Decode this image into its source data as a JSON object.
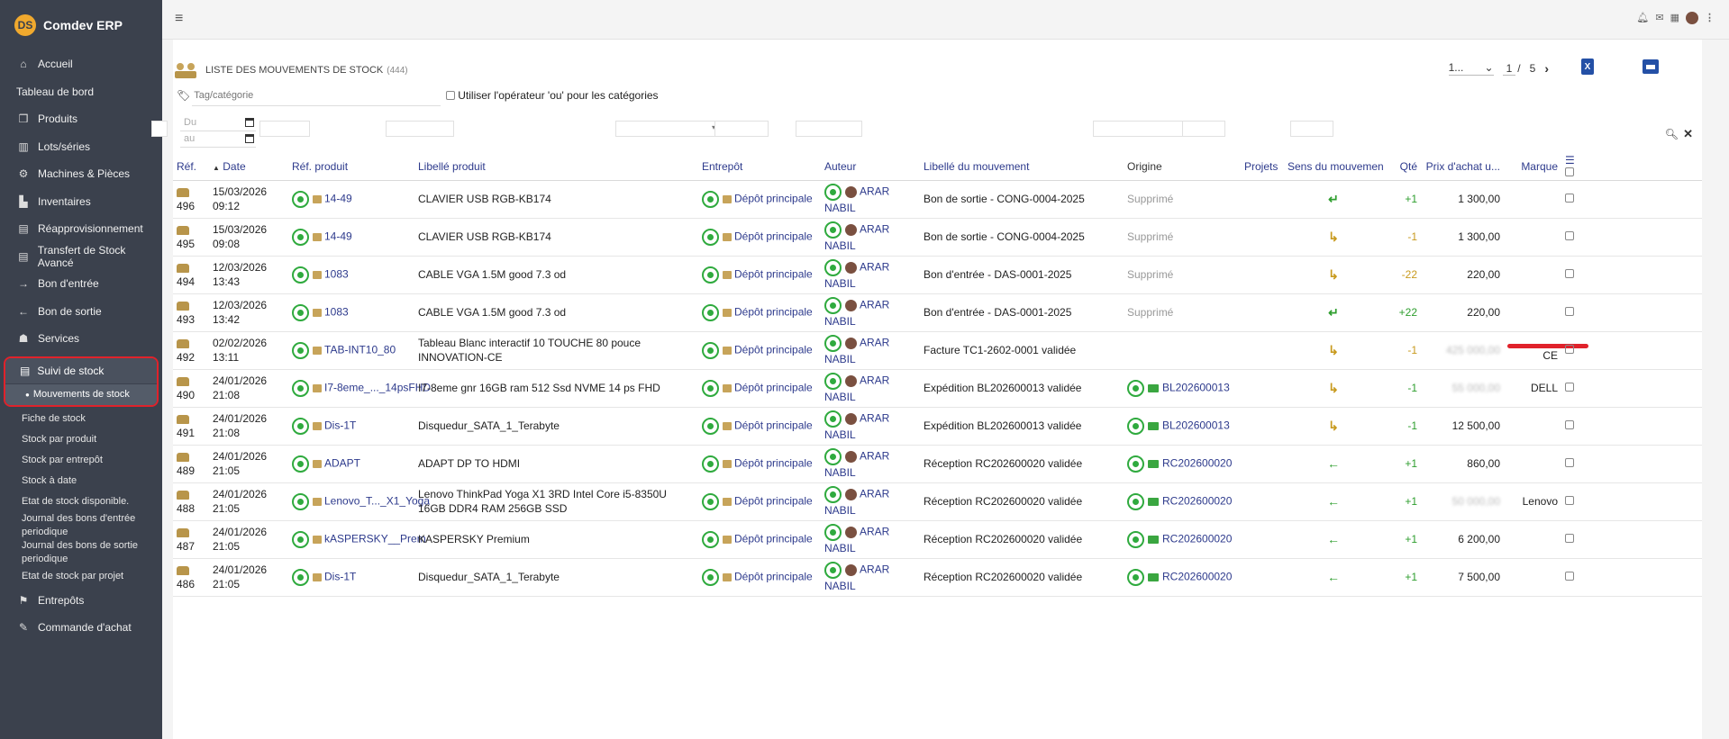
{
  "brand": {
    "logo_text": "DS",
    "name": "Comdev ERP"
  },
  "topbar": {
    "menu_icon": "hamburger-icon",
    "icons": [
      "bell-icon",
      "chat-icon",
      "calendar-icon",
      "user-avatar",
      "kebab-menu-icon"
    ]
  },
  "sidebar": {
    "items": [
      {
        "label": "Accueil",
        "icon": "home-icon",
        "glyph": "⌂"
      },
      {
        "label": "Tableau de bord",
        "icon": "",
        "glyph": ""
      },
      {
        "label": "Produits",
        "icon": "cube-icon",
        "glyph": "❒"
      },
      {
        "label": "Lots/séries",
        "icon": "barcode-icon",
        "glyph": "▥"
      },
      {
        "label": "Machines & Pièces",
        "icon": "gears-icon",
        "glyph": "⚙"
      },
      {
        "label": "Inventaires",
        "icon": "warehouse-icon",
        "glyph": "▙"
      },
      {
        "label": "Réapprovisionnement",
        "icon": "boxes-icon",
        "glyph": "▤"
      },
      {
        "label": "Transfert de Stock Avancé",
        "icon": "boxes-icon",
        "glyph": "▤"
      },
      {
        "label": "Bon d'entrée",
        "icon": "arrow-right-icon",
        "glyph": "→"
      },
      {
        "label": "Bon de sortie",
        "icon": "arrow-left-icon",
        "glyph": "←"
      },
      {
        "label": "Services",
        "icon": "services-icon",
        "glyph": "☗"
      }
    ],
    "active": {
      "label": "Suivi de stock",
      "sub_label": "Mouvements de stock"
    },
    "sub_items": [
      "Fiche de stock",
      "Stock par produit",
      "Stock par entrepôt",
      "Stock à date",
      "Etat de stock disponible.",
      "Journal des bons d'entrée periodique",
      "Journal des bons de sortie periodique",
      "Etat de stock par projet"
    ],
    "bottom_items": [
      {
        "label": "Entrepôts",
        "glyph": "⚑"
      },
      {
        "label": "Commande d'achat",
        "glyph": "✎"
      }
    ]
  },
  "page": {
    "title": "LISTE DES MOUVEMENTS DE STOCK",
    "count": "(444)",
    "pager": {
      "per_page": "1...",
      "current": "1",
      "separator": "/",
      "total": "5",
      "next": "›"
    },
    "export_label": "X"
  },
  "filters": {
    "tag_placeholder": "Tag/catégorie",
    "or_operator_label": "Utiliser l'opérateur 'ou' pour les catégories",
    "date_from_placeholder": "Du",
    "date_to_placeholder": "au"
  },
  "table": {
    "headers": {
      "ref": "Réf.",
      "date": "Date",
      "ref_produit": "Réf. produit",
      "libelle_produit": "Libellé produit",
      "entrepot": "Entrepôt",
      "auteur": "Auteur",
      "libelle_mouvement": "Libellé du mouvement",
      "origine": "Origine",
      "projets": "Projets",
      "sens": "Sens du mouvement",
      "qte": "Qté",
      "prix": "Prix d'achat u...",
      "marque": "Marque"
    },
    "sort_indicator": "▲",
    "rows": [
      {
        "ref": "496",
        "date": "15/03/2026 09:12",
        "ref_produit": "14-49",
        "libelle": "CLAVIER USB RGB-KB174",
        "entrepot": "Dépôt principale",
        "auteur": "ARAR NABIL",
        "mouvement": "Bon de sortie - CONG-0004-2025",
        "origine": "Supprimé",
        "origine_type": "deleted",
        "sens": "↵",
        "sens_color": "green",
        "qte": "+1",
        "qte_color": "green",
        "prix": "1 300,00",
        "prix_blur": false,
        "marque": ""
      },
      {
        "ref": "495",
        "date": "15/03/2026 09:08",
        "ref_produit": "14-49",
        "libelle": "CLAVIER USB RGB-KB174",
        "entrepot": "Dépôt principale",
        "auteur": "ARAR NABIL",
        "mouvement": "Bon de sortie - CONG-0004-2025",
        "origine": "Supprimé",
        "origine_type": "deleted",
        "sens": "↳",
        "sens_color": "gold",
        "qte": "-1",
        "qte_color": "gold",
        "prix": "1 300,00",
        "prix_blur": false,
        "marque": ""
      },
      {
        "ref": "494",
        "date": "12/03/2026 13:43",
        "ref_produit": "1083",
        "libelle": "CABLE VGA 1.5M good 7.3 od",
        "entrepot": "Dépôt principale",
        "auteur": "ARAR NABIL",
        "mouvement": "Bon d'entrée - DAS-0001-2025",
        "origine": "Supprimé",
        "origine_type": "deleted",
        "sens": "↳",
        "sens_color": "gold",
        "qte": "-22",
        "qte_color": "gold",
        "prix": "220,00",
        "prix_blur": false,
        "marque": ""
      },
      {
        "ref": "493",
        "date": "12/03/2026 13:42",
        "ref_produit": "1083",
        "libelle": "CABLE VGA 1.5M good 7.3 od",
        "entrepot": "Dépôt principale",
        "auteur": "ARAR NABIL",
        "mouvement": "Bon d'entrée - DAS-0001-2025",
        "origine": "Supprimé",
        "origine_type": "deleted",
        "sens": "↵",
        "sens_color": "green",
        "qte": "+22",
        "qte_color": "green",
        "prix": "220,00",
        "prix_blur": false,
        "marque": ""
      },
      {
        "ref": "492",
        "date": "02/02/2026 13:11",
        "ref_produit": "TAB-INT10_80",
        "libelle": "Tableau Blanc interactif 10 TOUCHE 80 pouce INNOVATION-CE",
        "entrepot": "Dépôt principale",
        "auteur": "ARAR NABIL",
        "mouvement": "Facture TC1-2602-0001 validée",
        "origine": "",
        "origine_type": "none",
        "sens": "↳",
        "sens_color": "gold",
        "qte": "-1",
        "qte_color": "gold",
        "prix": "425 000,00",
        "prix_blur": true,
        "marque": "CE",
        "marque_redline": true
      },
      {
        "ref": "490",
        "date": "24/01/2026 21:08",
        "ref_produit": "I7-8eme_..._14psFHD",
        "libelle": "I7-8eme gnr 16GB ram 512 Ssd NVME 14 ps FHD",
        "entrepot": "Dépôt principale",
        "auteur": "ARAR NABIL",
        "mouvement": "Expédition BL202600013 validée",
        "origine": "BL202600013",
        "origine_type": "link",
        "sens": "↳",
        "sens_color": "gold",
        "qte": "-1",
        "qte_color": "green",
        "prix": "55 000,00",
        "prix_blur": true,
        "marque": "DELL"
      },
      {
        "ref": "491",
        "date": "24/01/2026 21:08",
        "ref_produit": "Dis-1T",
        "libelle": "Disquedur_SATA_1_Terabyte",
        "entrepot": "Dépôt principale",
        "auteur": "ARAR NABIL",
        "mouvement": "Expédition BL202600013 validée",
        "origine": "BL202600013",
        "origine_type": "link",
        "sens": "↳",
        "sens_color": "gold",
        "qte": "-1",
        "qte_color": "green",
        "prix": "12 500,00",
        "prix_blur": false,
        "marque": ""
      },
      {
        "ref": "489",
        "date": "24/01/2026 21:05",
        "ref_produit": "ADAPT",
        "libelle": "ADAPT DP TO HDMI",
        "entrepot": "Dépôt principale",
        "auteur": "ARAR NABIL",
        "mouvement": "Réception RC202600020 validée",
        "origine": "RC202600020",
        "origine_type": "link",
        "sens": "←",
        "sens_color": "green",
        "qte": "+1",
        "qte_color": "green",
        "prix": "860,00",
        "prix_blur": false,
        "marque": ""
      },
      {
        "ref": "488",
        "date": "24/01/2026 21:05",
        "ref_produit": "Lenovo_T..._X1_Yoga",
        "libelle": "Lenovo ThinkPad Yoga X1 3RD Intel Core i5-8350U 16GB DDR4 RAM 256GB SSD",
        "entrepot": "Dépôt principale",
        "auteur": "ARAR NABIL",
        "mouvement": "Réception RC202600020 validée",
        "origine": "RC202600020",
        "origine_type": "link",
        "sens": "←",
        "sens_color": "green",
        "qte": "+1",
        "qte_color": "green",
        "prix": "50 000,00",
        "prix_blur": true,
        "marque": "Lenovo"
      },
      {
        "ref": "487",
        "date": "24/01/2026 21:05",
        "ref_produit": "kASPERSKY__Prem",
        "libelle": "KASPERSKY Premium",
        "entrepot": "Dépôt principale",
        "auteur": "ARAR NABIL",
        "mouvement": "Réception RC202600020 validée",
        "origine": "RC202600020",
        "origine_type": "link",
        "sens": "←",
        "sens_color": "green",
        "qte": "+1",
        "qte_color": "green",
        "prix": "6 200,00",
        "prix_blur": false,
        "marque": ""
      },
      {
        "ref": "486",
        "date": "24/01/2026 21:05",
        "ref_produit": "Dis-1T",
        "libelle": "Disquedur_SATA_1_Terabyte",
        "entrepot": "Dépôt principale",
        "auteur": "ARAR NABIL",
        "mouvement": "Réception RC202600020 validée",
        "origine": "RC202600020",
        "origine_type": "link",
        "sens": "←",
        "sens_color": "green",
        "qte": "+1",
        "qte_color": "green",
        "prix": "7 500,00",
        "prix_blur": false,
        "marque": ""
      }
    ]
  },
  "colors": {
    "sidebar_bg": "#3b414d",
    "link": "#2d3a8c",
    "green": "#2e9e2e",
    "gold": "#c89a1e",
    "highlight_red": "#e0222b"
  }
}
